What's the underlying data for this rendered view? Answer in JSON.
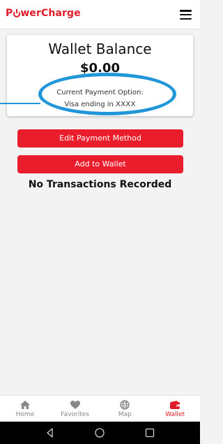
{
  "app": {
    "brand_pre": "P",
    "brand_post": "werCharge",
    "brand_color": "#e01b2a"
  },
  "wallet": {
    "title": "Wallet Balance",
    "amount": "$0.00",
    "payment_option_label": "Current Payment Option:",
    "payment_card_prefix": "Visa ending in",
    "payment_card_masked": "XXXX"
  },
  "actions": {
    "edit_payment": "Edit Payment Method",
    "add_to_wallet": "Add to Wallet"
  },
  "transactions": {
    "empty_message": "No Transactions Recorded"
  },
  "tabs": [
    {
      "label": "Home",
      "icon": "home-icon"
    },
    {
      "label": "Favorites",
      "icon": "heart-icon"
    },
    {
      "label": "Map",
      "icon": "globe-icon"
    },
    {
      "label": "Wallet",
      "icon": "wallet-icon",
      "active": true
    }
  ],
  "colors": {
    "accent": "#ea1d2c",
    "highlight": "#2196d8",
    "inactive_tab": "#888888"
  }
}
